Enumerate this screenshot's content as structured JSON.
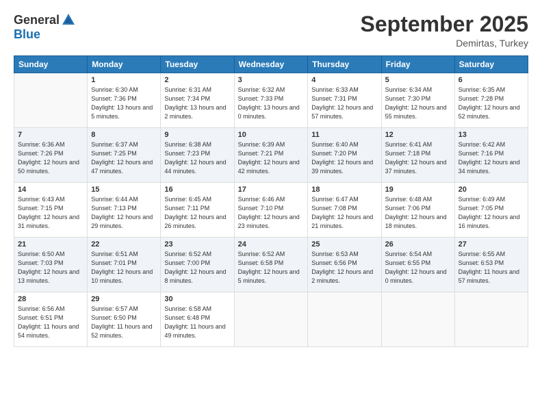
{
  "header": {
    "logo_general": "General",
    "logo_blue": "Blue",
    "month_title": "September 2025",
    "subtitle": "Demirtas, Turkey"
  },
  "weekdays": [
    "Sunday",
    "Monday",
    "Tuesday",
    "Wednesday",
    "Thursday",
    "Friday",
    "Saturday"
  ],
  "weeks": [
    [
      {
        "day": "",
        "sunrise": "",
        "sunset": "",
        "daylight": ""
      },
      {
        "day": "1",
        "sunrise": "Sunrise: 6:30 AM",
        "sunset": "Sunset: 7:36 PM",
        "daylight": "Daylight: 13 hours and 5 minutes."
      },
      {
        "day": "2",
        "sunrise": "Sunrise: 6:31 AM",
        "sunset": "Sunset: 7:34 PM",
        "daylight": "Daylight: 13 hours and 2 minutes."
      },
      {
        "day": "3",
        "sunrise": "Sunrise: 6:32 AM",
        "sunset": "Sunset: 7:33 PM",
        "daylight": "Daylight: 13 hours and 0 minutes."
      },
      {
        "day": "4",
        "sunrise": "Sunrise: 6:33 AM",
        "sunset": "Sunset: 7:31 PM",
        "daylight": "Daylight: 12 hours and 57 minutes."
      },
      {
        "day": "5",
        "sunrise": "Sunrise: 6:34 AM",
        "sunset": "Sunset: 7:30 PM",
        "daylight": "Daylight: 12 hours and 55 minutes."
      },
      {
        "day": "6",
        "sunrise": "Sunrise: 6:35 AM",
        "sunset": "Sunset: 7:28 PM",
        "daylight": "Daylight: 12 hours and 52 minutes."
      }
    ],
    [
      {
        "day": "7",
        "sunrise": "Sunrise: 6:36 AM",
        "sunset": "Sunset: 7:26 PM",
        "daylight": "Daylight: 12 hours and 50 minutes."
      },
      {
        "day": "8",
        "sunrise": "Sunrise: 6:37 AM",
        "sunset": "Sunset: 7:25 PM",
        "daylight": "Daylight: 12 hours and 47 minutes."
      },
      {
        "day": "9",
        "sunrise": "Sunrise: 6:38 AM",
        "sunset": "Sunset: 7:23 PM",
        "daylight": "Daylight: 12 hours and 44 minutes."
      },
      {
        "day": "10",
        "sunrise": "Sunrise: 6:39 AM",
        "sunset": "Sunset: 7:21 PM",
        "daylight": "Daylight: 12 hours and 42 minutes."
      },
      {
        "day": "11",
        "sunrise": "Sunrise: 6:40 AM",
        "sunset": "Sunset: 7:20 PM",
        "daylight": "Daylight: 12 hours and 39 minutes."
      },
      {
        "day": "12",
        "sunrise": "Sunrise: 6:41 AM",
        "sunset": "Sunset: 7:18 PM",
        "daylight": "Daylight: 12 hours and 37 minutes."
      },
      {
        "day": "13",
        "sunrise": "Sunrise: 6:42 AM",
        "sunset": "Sunset: 7:16 PM",
        "daylight": "Daylight: 12 hours and 34 minutes."
      }
    ],
    [
      {
        "day": "14",
        "sunrise": "Sunrise: 6:43 AM",
        "sunset": "Sunset: 7:15 PM",
        "daylight": "Daylight: 12 hours and 31 minutes."
      },
      {
        "day": "15",
        "sunrise": "Sunrise: 6:44 AM",
        "sunset": "Sunset: 7:13 PM",
        "daylight": "Daylight: 12 hours and 29 minutes."
      },
      {
        "day": "16",
        "sunrise": "Sunrise: 6:45 AM",
        "sunset": "Sunset: 7:11 PM",
        "daylight": "Daylight: 12 hours and 26 minutes."
      },
      {
        "day": "17",
        "sunrise": "Sunrise: 6:46 AM",
        "sunset": "Sunset: 7:10 PM",
        "daylight": "Daylight: 12 hours and 23 minutes."
      },
      {
        "day": "18",
        "sunrise": "Sunrise: 6:47 AM",
        "sunset": "Sunset: 7:08 PM",
        "daylight": "Daylight: 12 hours and 21 minutes."
      },
      {
        "day": "19",
        "sunrise": "Sunrise: 6:48 AM",
        "sunset": "Sunset: 7:06 PM",
        "daylight": "Daylight: 12 hours and 18 minutes."
      },
      {
        "day": "20",
        "sunrise": "Sunrise: 6:49 AM",
        "sunset": "Sunset: 7:05 PM",
        "daylight": "Daylight: 12 hours and 16 minutes."
      }
    ],
    [
      {
        "day": "21",
        "sunrise": "Sunrise: 6:50 AM",
        "sunset": "Sunset: 7:03 PM",
        "daylight": "Daylight: 12 hours and 13 minutes."
      },
      {
        "day": "22",
        "sunrise": "Sunrise: 6:51 AM",
        "sunset": "Sunset: 7:01 PM",
        "daylight": "Daylight: 12 hours and 10 minutes."
      },
      {
        "day": "23",
        "sunrise": "Sunrise: 6:52 AM",
        "sunset": "Sunset: 7:00 PM",
        "daylight": "Daylight: 12 hours and 8 minutes."
      },
      {
        "day": "24",
        "sunrise": "Sunrise: 6:52 AM",
        "sunset": "Sunset: 6:58 PM",
        "daylight": "Daylight: 12 hours and 5 minutes."
      },
      {
        "day": "25",
        "sunrise": "Sunrise: 6:53 AM",
        "sunset": "Sunset: 6:56 PM",
        "daylight": "Daylight: 12 hours and 2 minutes."
      },
      {
        "day": "26",
        "sunrise": "Sunrise: 6:54 AM",
        "sunset": "Sunset: 6:55 PM",
        "daylight": "Daylight: 12 hours and 0 minutes."
      },
      {
        "day": "27",
        "sunrise": "Sunrise: 6:55 AM",
        "sunset": "Sunset: 6:53 PM",
        "daylight": "Daylight: 11 hours and 57 minutes."
      }
    ],
    [
      {
        "day": "28",
        "sunrise": "Sunrise: 6:56 AM",
        "sunset": "Sunset: 6:51 PM",
        "daylight": "Daylight: 11 hours and 54 minutes."
      },
      {
        "day": "29",
        "sunrise": "Sunrise: 6:57 AM",
        "sunset": "Sunset: 6:50 PM",
        "daylight": "Daylight: 11 hours and 52 minutes."
      },
      {
        "day": "30",
        "sunrise": "Sunrise: 6:58 AM",
        "sunset": "Sunset: 6:48 PM",
        "daylight": "Daylight: 11 hours and 49 minutes."
      },
      {
        "day": "",
        "sunrise": "",
        "sunset": "",
        "daylight": ""
      },
      {
        "day": "",
        "sunrise": "",
        "sunset": "",
        "daylight": ""
      },
      {
        "day": "",
        "sunrise": "",
        "sunset": "",
        "daylight": ""
      },
      {
        "day": "",
        "sunrise": "",
        "sunset": "",
        "daylight": ""
      }
    ]
  ]
}
